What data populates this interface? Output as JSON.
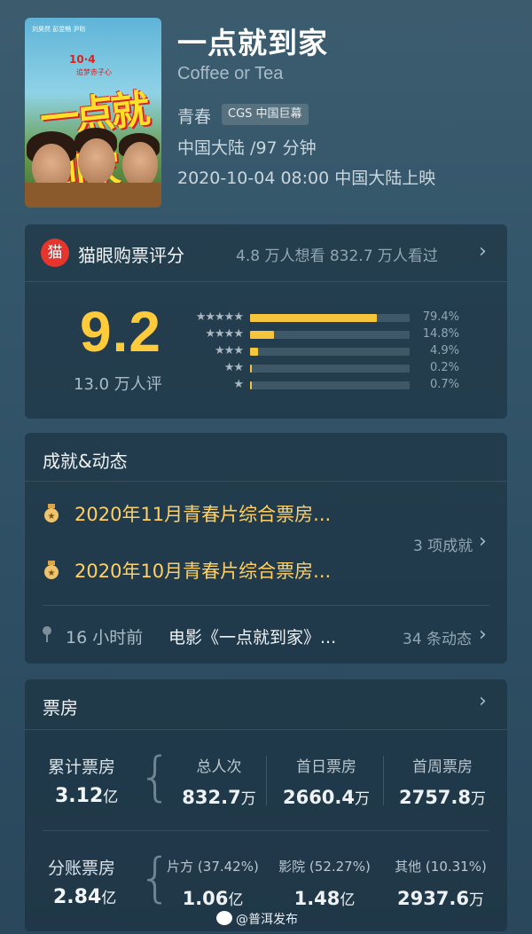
{
  "movie": {
    "title": "一点就到家",
    "english_title": "Coffee or Tea",
    "genre": "青春",
    "format_badge": "CGS 中国巨幕",
    "region_duration": "中国大陆 /97 分钟",
    "release": "2020-10-04 08:00 中国大陆上映",
    "poster": {
      "credits": "刘昊然   彭昱畅   尹昉",
      "date_text": "10·4",
      "tagline": "追梦赤子心",
      "logo_text": "一点就到家"
    }
  },
  "rating": {
    "icon_glyph": "猫",
    "title": "猫眼购票评分",
    "stats": "4.8 万人想看  832.7 万人看过",
    "score": "9.2",
    "count": "13.0 万人评",
    "distribution": [
      {
        "stars": "★★★★★",
        "percent": "79.4%",
        "value": 0.794
      },
      {
        "stars": "★★★★",
        "percent": "14.8%",
        "value": 0.148
      },
      {
        "stars": "★★★",
        "percent": "4.9%",
        "value": 0.049
      },
      {
        "stars": "★★",
        "percent": "0.2%",
        "value": 0.002
      },
      {
        "stars": "★",
        "percent": "0.7%",
        "value": 0.007
      }
    ]
  },
  "achievements": {
    "title": "成就&动态",
    "items": [
      {
        "text": "2020年11月青春片综合票房..."
      },
      {
        "text": "2020年10月青春片综合票房..."
      }
    ],
    "more": "3 项成就",
    "dynamic": {
      "time": "16 小时前",
      "text": "电影《一点就到家》...",
      "more": "34 条动态"
    }
  },
  "box_office": {
    "title": "票房",
    "cumulative": {
      "label": "累计票房",
      "value": "3.12",
      "unit": "亿",
      "columns": [
        {
          "header": "总人次",
          "value": "832.7",
          "unit": "万"
        },
        {
          "header": "首日票房",
          "value": "2660.4",
          "unit": "万"
        },
        {
          "header": "首周票房",
          "value": "2757.8",
          "unit": "万"
        }
      ]
    },
    "split": {
      "label": "分账票房",
      "value": "2.84",
      "unit": "亿",
      "columns": [
        {
          "header": "片方 (37.42%)",
          "value": "1.06",
          "unit": "亿"
        },
        {
          "header": "影院 (52.27%)",
          "value": "1.48",
          "unit": "亿"
        },
        {
          "header": "其他 (10.31%)",
          "value": "2937.6",
          "unit": "万"
        }
      ]
    }
  },
  "watermark": "@普洱发布",
  "colors": {
    "accent": "#ffcb3b",
    "bar": "#f5c63b",
    "achievement": "#ffd066",
    "maoyan_red": "#e5352d"
  }
}
